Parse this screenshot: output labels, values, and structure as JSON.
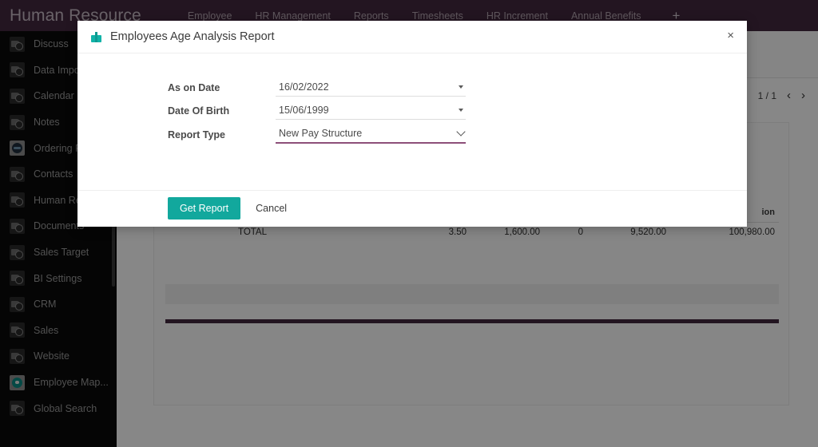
{
  "header": {
    "brand": "Human Resource",
    "nav": [
      {
        "label": "Employee"
      },
      {
        "label": "HR Management"
      },
      {
        "label": "Reports"
      },
      {
        "label": "Timesheets"
      },
      {
        "label": "HR Increment"
      },
      {
        "label": "Annual Benefits"
      }
    ],
    "add_label": "+"
  },
  "sidebar": {
    "items": [
      {
        "label": "Discuss",
        "icon": "broken-image-icon"
      },
      {
        "label": "Data Import",
        "icon": "broken-image-icon"
      },
      {
        "label": "Calendar",
        "icon": "broken-image-icon"
      },
      {
        "label": "Notes",
        "icon": "broken-image-icon"
      },
      {
        "label": "Ordering Po",
        "icon": "ordering-policy-icon"
      },
      {
        "label": "Contacts",
        "icon": "broken-image-icon"
      },
      {
        "label": "Human Resour...",
        "icon": "broken-image-icon"
      },
      {
        "label": "Documents",
        "icon": "broken-image-icon"
      },
      {
        "label": "Sales Target",
        "icon": "broken-image-icon"
      },
      {
        "label": "BI Settings",
        "icon": "broken-image-icon"
      },
      {
        "label": "CRM",
        "icon": "broken-image-icon"
      },
      {
        "label": "Sales",
        "icon": "broken-image-icon"
      },
      {
        "label": "Website",
        "icon": "broken-image-icon"
      },
      {
        "label": "Employee Map...",
        "icon": "map-pin-icon"
      },
      {
        "label": "Global Search",
        "icon": "broken-image-icon"
      }
    ]
  },
  "page": {
    "pager": {
      "count": "1 / 1",
      "prev": "‹",
      "next": "›"
    },
    "report": {
      "columns": [
        "",
        "",
        "",
        "",
        "",
        "",
        "",
        "ion"
      ],
      "total_label": "TOTAL",
      "total_row": [
        "3.50",
        "1,600.00",
        "0",
        "9,520.00",
        "100,980.00"
      ]
    }
  },
  "modal": {
    "title": "Employees Age Analysis Report",
    "title_icon": "gift-icon",
    "close_label": "×",
    "fields": [
      {
        "label": "As on Date",
        "value": "16/02/2022",
        "control": "date"
      },
      {
        "label": "Date Of Birth",
        "value": "15/06/1999",
        "control": "date"
      },
      {
        "label": "Report Type",
        "value": "New Pay Structure",
        "control": "select"
      }
    ],
    "report_type_options": [
      "New Pay Structure"
    ],
    "primary_button": "Get Report",
    "secondary_button": "Cancel"
  },
  "colors": {
    "header_purple": "#43293f",
    "accent_teal": "#12a89d",
    "focus_underline": "#8d4f79",
    "sidebar_bg": "#0a0a0a"
  }
}
